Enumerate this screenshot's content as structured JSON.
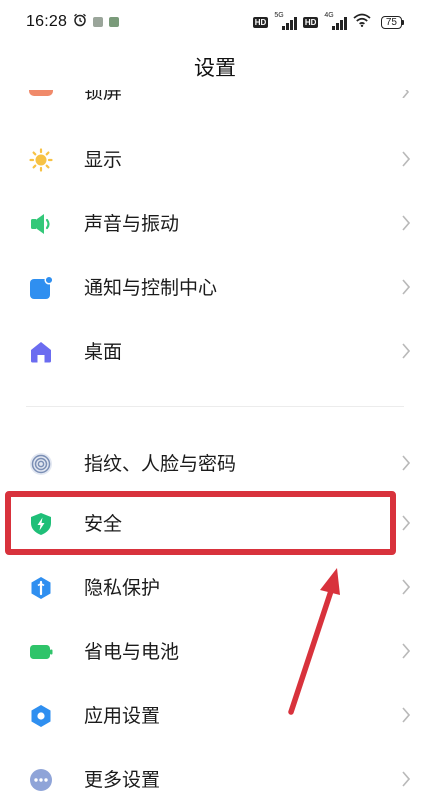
{
  "status_bar": {
    "time": "16:28",
    "hd1": "HD",
    "net1": "5G",
    "hd2": "HD",
    "net2": "4G",
    "battery": "75"
  },
  "header": {
    "title": "设置"
  },
  "settings": {
    "partial_label": "锁屏",
    "items": [
      {
        "label": "显示",
        "icon": "brightness-icon"
      },
      {
        "label": "声音与振动",
        "icon": "speaker-icon"
      },
      {
        "label": "通知与控制中心",
        "icon": "notification-icon"
      },
      {
        "label": "桌面",
        "icon": "home-icon"
      },
      {
        "label": "指纹、人脸与密码",
        "icon": "fingerprint-icon"
      },
      {
        "label": "安全",
        "icon": "shield-icon"
      },
      {
        "label": "隐私保护",
        "icon": "privacy-icon"
      },
      {
        "label": "省电与电池",
        "icon": "battery-icon"
      },
      {
        "label": "应用设置",
        "icon": "app-settings-gear-icon"
      },
      {
        "label": "更多设置",
        "icon": "more-icon"
      }
    ]
  },
  "colors": {
    "highlight": "#d8323c",
    "display_icon": "#f7c244",
    "sound_icon": "#34c879",
    "notification_icon": "#2f8ff0",
    "home_icon": "#6b6cf0",
    "fingerprint_icon": "#7b8fb5",
    "security_icon": "#1fbf78",
    "privacy_icon": "#2f8ff0",
    "battery_icon": "#2fc46a",
    "app_settings_icon": "#2f8ff0",
    "more_icon": "#8fa4d8"
  }
}
